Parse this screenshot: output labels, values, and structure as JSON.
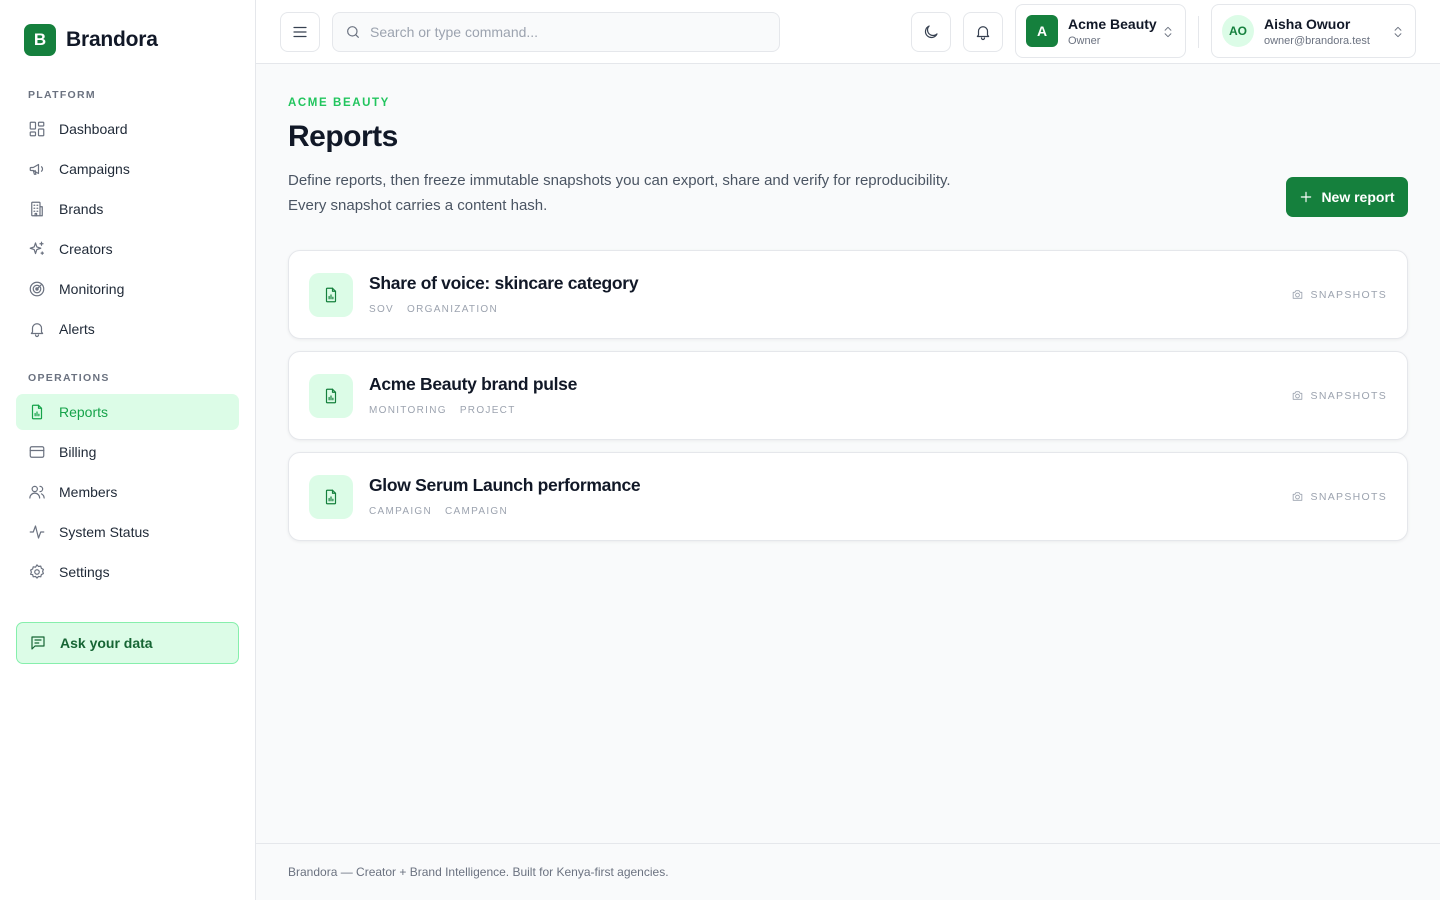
{
  "brand": {
    "logo_letter": "B",
    "name": "Brandora"
  },
  "sidebar": {
    "platform_label": "PLATFORM",
    "platform_items": [
      {
        "label": "Dashboard",
        "icon": "dashboard-icon"
      },
      {
        "label": "Campaigns",
        "icon": "megaphone-icon"
      },
      {
        "label": "Brands",
        "icon": "building-icon"
      },
      {
        "label": "Creators",
        "icon": "sparkles-icon"
      },
      {
        "label": "Monitoring",
        "icon": "radar-icon"
      },
      {
        "label": "Alerts",
        "icon": "bell-icon"
      }
    ],
    "operations_label": "OPERATIONS",
    "operations_items": [
      {
        "label": "Reports",
        "icon": "report-icon",
        "active": true
      },
      {
        "label": "Billing",
        "icon": "credit-card-icon"
      },
      {
        "label": "Members",
        "icon": "users-icon"
      },
      {
        "label": "System Status",
        "icon": "activity-icon"
      },
      {
        "label": "Settings",
        "icon": "gear-icon"
      }
    ],
    "ask_label": "Ask your data"
  },
  "topbar": {
    "search_placeholder": "Search or type command...",
    "org": {
      "avatar_letter": "A",
      "name": "Acme Beauty",
      "role": "Owner"
    },
    "user": {
      "initials": "AO",
      "name": "Aisha Owuor",
      "email": "owner@brandora.test"
    }
  },
  "page": {
    "eyebrow": "ACME BEAUTY",
    "title": "Reports",
    "description_line1": "Define reports, then freeze immutable snapshots you can export, share and verify for reproducibility.",
    "description_line2": "Every snapshot carries a content hash.",
    "new_button_label": "New report"
  },
  "reports": [
    {
      "title": "Share of voice: skincare category",
      "tags": [
        "SOV",
        "ORGANIZATION"
      ],
      "snapshots_label": "SNAPSHOTS"
    },
    {
      "title": "Acme Beauty brand pulse",
      "tags": [
        "MONITORING",
        "PROJECT"
      ],
      "snapshots_label": "SNAPSHOTS"
    },
    {
      "title": "Glow Serum Launch performance",
      "tags": [
        "CAMPAIGN",
        "CAMPAIGN"
      ],
      "snapshots_label": "SNAPSHOTS"
    }
  ],
  "footer": {
    "text": "Brandora — Creator + Brand Intelligence. Built for Kenya-first agencies."
  },
  "colors": {
    "accent": "#15803d",
    "accent_light": "#dcfce7",
    "accent_text": "#22c55e"
  }
}
